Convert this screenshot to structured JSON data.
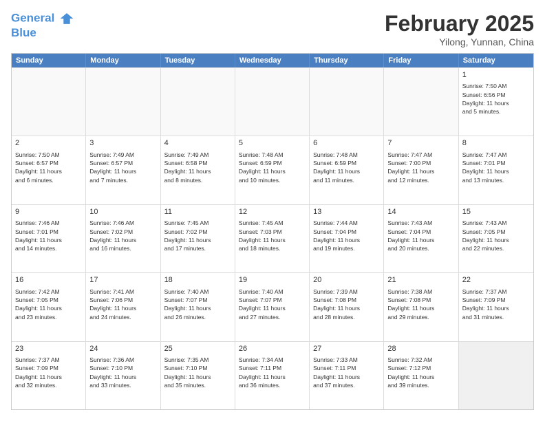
{
  "header": {
    "logo_line1": "General",
    "logo_line2": "Blue",
    "month": "February 2025",
    "location": "Yilong, Yunnan, China"
  },
  "days_of_week": [
    "Sunday",
    "Monday",
    "Tuesday",
    "Wednesday",
    "Thursday",
    "Friday",
    "Saturday"
  ],
  "rows": [
    [
      {
        "num": "",
        "text": ""
      },
      {
        "num": "",
        "text": ""
      },
      {
        "num": "",
        "text": ""
      },
      {
        "num": "",
        "text": ""
      },
      {
        "num": "",
        "text": ""
      },
      {
        "num": "",
        "text": ""
      },
      {
        "num": "1",
        "text": "Sunrise: 7:50 AM\nSunset: 6:56 PM\nDaylight: 11 hours\nand 5 minutes."
      }
    ],
    [
      {
        "num": "2",
        "text": "Sunrise: 7:50 AM\nSunset: 6:57 PM\nDaylight: 11 hours\nand 6 minutes."
      },
      {
        "num": "3",
        "text": "Sunrise: 7:49 AM\nSunset: 6:57 PM\nDaylight: 11 hours\nand 7 minutes."
      },
      {
        "num": "4",
        "text": "Sunrise: 7:49 AM\nSunset: 6:58 PM\nDaylight: 11 hours\nand 8 minutes."
      },
      {
        "num": "5",
        "text": "Sunrise: 7:48 AM\nSunset: 6:59 PM\nDaylight: 11 hours\nand 10 minutes."
      },
      {
        "num": "6",
        "text": "Sunrise: 7:48 AM\nSunset: 6:59 PM\nDaylight: 11 hours\nand 11 minutes."
      },
      {
        "num": "7",
        "text": "Sunrise: 7:47 AM\nSunset: 7:00 PM\nDaylight: 11 hours\nand 12 minutes."
      },
      {
        "num": "8",
        "text": "Sunrise: 7:47 AM\nSunset: 7:01 PM\nDaylight: 11 hours\nand 13 minutes."
      }
    ],
    [
      {
        "num": "9",
        "text": "Sunrise: 7:46 AM\nSunset: 7:01 PM\nDaylight: 11 hours\nand 14 minutes."
      },
      {
        "num": "10",
        "text": "Sunrise: 7:46 AM\nSunset: 7:02 PM\nDaylight: 11 hours\nand 16 minutes."
      },
      {
        "num": "11",
        "text": "Sunrise: 7:45 AM\nSunset: 7:02 PM\nDaylight: 11 hours\nand 17 minutes."
      },
      {
        "num": "12",
        "text": "Sunrise: 7:45 AM\nSunset: 7:03 PM\nDaylight: 11 hours\nand 18 minutes."
      },
      {
        "num": "13",
        "text": "Sunrise: 7:44 AM\nSunset: 7:04 PM\nDaylight: 11 hours\nand 19 minutes."
      },
      {
        "num": "14",
        "text": "Sunrise: 7:43 AM\nSunset: 7:04 PM\nDaylight: 11 hours\nand 20 minutes."
      },
      {
        "num": "15",
        "text": "Sunrise: 7:43 AM\nSunset: 7:05 PM\nDaylight: 11 hours\nand 22 minutes."
      }
    ],
    [
      {
        "num": "16",
        "text": "Sunrise: 7:42 AM\nSunset: 7:05 PM\nDaylight: 11 hours\nand 23 minutes."
      },
      {
        "num": "17",
        "text": "Sunrise: 7:41 AM\nSunset: 7:06 PM\nDaylight: 11 hours\nand 24 minutes."
      },
      {
        "num": "18",
        "text": "Sunrise: 7:40 AM\nSunset: 7:07 PM\nDaylight: 11 hours\nand 26 minutes."
      },
      {
        "num": "19",
        "text": "Sunrise: 7:40 AM\nSunset: 7:07 PM\nDaylight: 11 hours\nand 27 minutes."
      },
      {
        "num": "20",
        "text": "Sunrise: 7:39 AM\nSunset: 7:08 PM\nDaylight: 11 hours\nand 28 minutes."
      },
      {
        "num": "21",
        "text": "Sunrise: 7:38 AM\nSunset: 7:08 PM\nDaylight: 11 hours\nand 29 minutes."
      },
      {
        "num": "22",
        "text": "Sunrise: 7:37 AM\nSunset: 7:09 PM\nDaylight: 11 hours\nand 31 minutes."
      }
    ],
    [
      {
        "num": "23",
        "text": "Sunrise: 7:37 AM\nSunset: 7:09 PM\nDaylight: 11 hours\nand 32 minutes."
      },
      {
        "num": "24",
        "text": "Sunrise: 7:36 AM\nSunset: 7:10 PM\nDaylight: 11 hours\nand 33 minutes."
      },
      {
        "num": "25",
        "text": "Sunrise: 7:35 AM\nSunset: 7:10 PM\nDaylight: 11 hours\nand 35 minutes."
      },
      {
        "num": "26",
        "text": "Sunrise: 7:34 AM\nSunset: 7:11 PM\nDaylight: 11 hours\nand 36 minutes."
      },
      {
        "num": "27",
        "text": "Sunrise: 7:33 AM\nSunset: 7:11 PM\nDaylight: 11 hours\nand 37 minutes."
      },
      {
        "num": "28",
        "text": "Sunrise: 7:32 AM\nSunset: 7:12 PM\nDaylight: 11 hours\nand 39 minutes."
      },
      {
        "num": "",
        "text": ""
      }
    ]
  ]
}
